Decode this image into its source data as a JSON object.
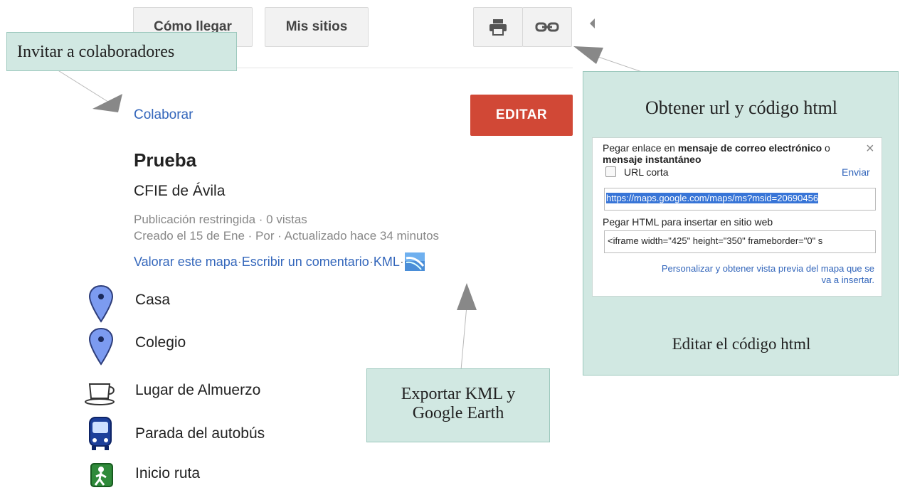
{
  "toolbar": {
    "directions_label": "Cómo llegar",
    "my_places_label": "Mis sitios",
    "print_icon": "print-icon",
    "link_icon": "link-icon",
    "collapse_icon": "collapse-left-icon"
  },
  "map_panel": {
    "collaborate_label": "Colaborar",
    "edit_label": "EDITAR",
    "title": "Prueba",
    "subtitle": "CFIE de Ávila",
    "meta_line1": "Publicación restringida · 0 vistas",
    "meta_line2": "Creado el 15 de Ene · Por  · Actualizado hace 34 minutos",
    "rate_label": "Valorar este mapa",
    "comment_label": "Escribir un comentario",
    "kml_label": "KML",
    "sep": " · ",
    "places": [
      {
        "label": "Casa",
        "icon": "blue-marker-icon"
      },
      {
        "label": "Colegio",
        "icon": "blue-marker-icon"
      },
      {
        "label": "Lugar de Almuerzo",
        "icon": "coffee-cup-icon"
      },
      {
        "label": "Parada del autobús",
        "icon": "bus-icon"
      },
      {
        "label": "Inicio ruta",
        "icon": "hiker-icon"
      }
    ]
  },
  "share_popup": {
    "intro_prefix": "Pegar enlace en ",
    "intro_bold1": "mensaje de correo electrónico",
    "intro_mid": " o",
    "intro_bold2": "mensaje instantáneo",
    "short_url_label": "URL corta",
    "send_label": "Enviar",
    "url_value": "https://maps.google.com/maps/ms?msid=20690456",
    "html_label": "Pegar HTML para insertar en sitio web",
    "html_value": "<iframe width=\"425\" height=\"350\" frameborder=\"0\" s",
    "customize_line1": "Personalizar y obtener vista previa del mapa que se",
    "customize_line2": "va a insertar.",
    "close_icon": "close-icon"
  },
  "annotations": {
    "invite": "Invitar a colaboradores",
    "get_url": "Obtener url y código html",
    "edit_html": "Editar el código html",
    "export_line1": "Exportar KML y",
    "export_line2": "Google Earth"
  },
  "colors": {
    "edit_button": "#d14836",
    "link": "#3366bb",
    "note_bg": "#d1e8e2",
    "url_highlight": "#3875d7"
  }
}
